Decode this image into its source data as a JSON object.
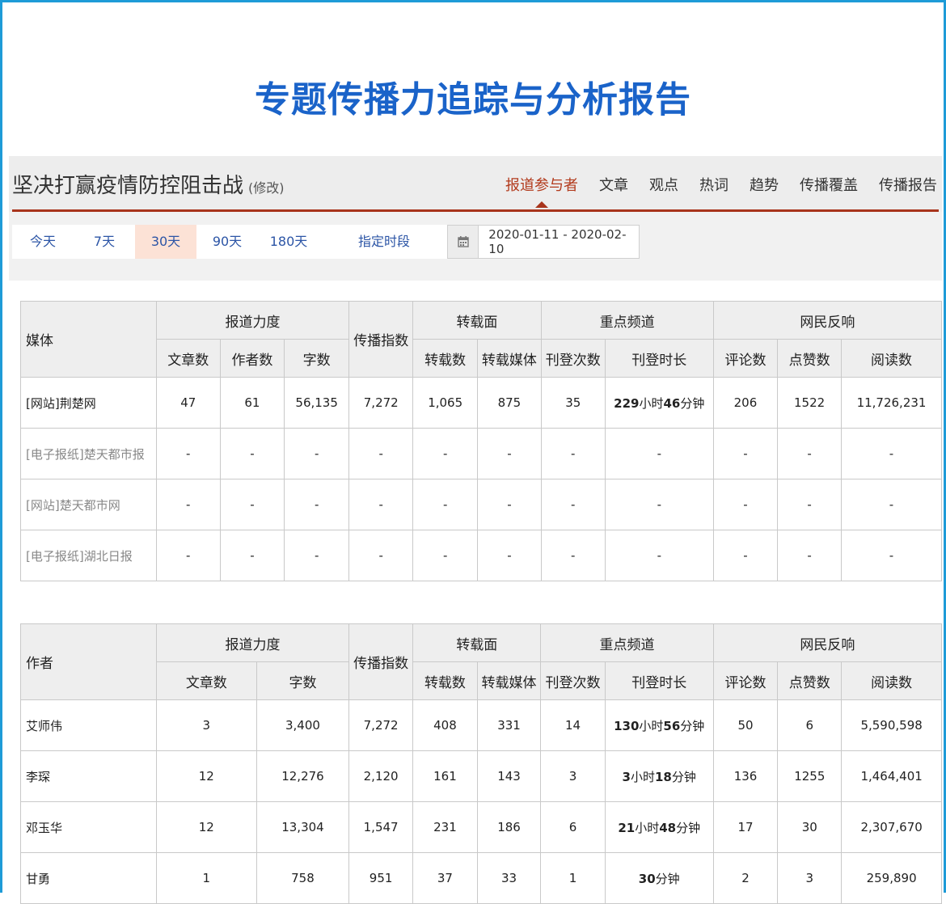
{
  "report_title": "专题传播力追踪与分析报告",
  "subject": {
    "title": "坚决打赢疫情防控阻击战",
    "edit_label": "(修改)"
  },
  "nav_tabs": [
    "报道参与者",
    "文章",
    "观点",
    "热词",
    "趋势",
    "传播覆盖",
    "传播报告"
  ],
  "active_tab": "报道参与者",
  "ranges": [
    "今天",
    "7天",
    "30天",
    "90天",
    "180天"
  ],
  "active_range": "30天",
  "custom_range_label": "指定时段",
  "date_range": "2020-01-11 - 2020-02-10",
  "colors": {
    "title": "#1a63c9",
    "accent": "#a8341c",
    "frame": "#1e9bd7",
    "active_range_bg": "#fce2d6"
  },
  "headers": {
    "media": "媒体",
    "author": "作者",
    "coverage": "报道力度",
    "index": "传播指数",
    "reprint": "转载面",
    "key_channel": "重点频道",
    "reaction": "网民反响",
    "articles": "文章数",
    "authors": "作者数",
    "words": "字数",
    "reprints": "转载数",
    "reprint_media": "转载媒体",
    "placements": "刊登次数",
    "duration": "刊登时长",
    "comments": "评论数",
    "likes": "点赞数",
    "reads": "阅读数"
  },
  "media_rows": [
    {
      "name": "[网站]荆楚网",
      "articles": "47",
      "authors": "61",
      "words": "56,135",
      "index": "7,272",
      "reprints": "1,065",
      "reprint_media": "875",
      "placements": "35",
      "dur": [
        {
          "n": "229"
        },
        {
          "u": "小时"
        },
        {
          "n": "46"
        },
        {
          "u": "分钟"
        }
      ],
      "comments": "206",
      "likes": "1522",
      "reads": "11,726,231",
      "dim": false
    },
    {
      "name": "[电子报纸]楚天都市报",
      "articles": "-",
      "authors": "-",
      "words": "-",
      "index": "-",
      "reprints": "-",
      "reprint_media": "-",
      "placements": "-",
      "dur": [
        {
          "u": "-"
        }
      ],
      "comments": "-",
      "likes": "-",
      "reads": "-",
      "dim": true
    },
    {
      "name": "[网站]楚天都市网",
      "articles": "-",
      "authors": "-",
      "words": "-",
      "index": "-",
      "reprints": "-",
      "reprint_media": "-",
      "placements": "-",
      "dur": [
        {
          "u": "-"
        }
      ],
      "comments": "-",
      "likes": "-",
      "reads": "-",
      "dim": true
    },
    {
      "name": "[电子报纸]湖北日报",
      "articles": "-",
      "authors": "-",
      "words": "-",
      "index": "-",
      "reprints": "-",
      "reprint_media": "-",
      "placements": "-",
      "dur": [
        {
          "u": "-"
        }
      ],
      "comments": "-",
      "likes": "-",
      "reads": "-",
      "dim": true
    }
  ],
  "author_rows": [
    {
      "name": "艾师伟",
      "articles": "3",
      "words": "3,400",
      "index": "7,272",
      "reprints": "408",
      "reprint_media": "331",
      "placements": "14",
      "dur": [
        {
          "n": "130"
        },
        {
          "u": "小时"
        },
        {
          "n": "56"
        },
        {
          "u": "分钟"
        }
      ],
      "comments": "50",
      "likes": "6",
      "reads": "5,590,598"
    },
    {
      "name": "李琛",
      "articles": "12",
      "words": "12,276",
      "index": "2,120",
      "reprints": "161",
      "reprint_media": "143",
      "placements": "3",
      "dur": [
        {
          "n": "3"
        },
        {
          "u": "小时"
        },
        {
          "n": "18"
        },
        {
          "u": "分钟"
        }
      ],
      "comments": "136",
      "likes": "1255",
      "reads": "1,464,401"
    },
    {
      "name": "邓玉华",
      "articles": "12",
      "words": "13,304",
      "index": "1,547",
      "reprints": "231",
      "reprint_media": "186",
      "placements": "6",
      "dur": [
        {
          "n": "21"
        },
        {
          "u": "小时"
        },
        {
          "n": "48"
        },
        {
          "u": "分钟"
        }
      ],
      "comments": "17",
      "likes": "30",
      "reads": "2,307,670"
    },
    {
      "name": "甘勇",
      "articles": "1",
      "words": "758",
      "index": "951",
      "reprints": "37",
      "reprint_media": "33",
      "placements": "1",
      "dur": [
        {
          "n": "30"
        },
        {
          "u": "分钟"
        }
      ],
      "comments": "2",
      "likes": "3",
      "reads": "259,890"
    }
  ]
}
